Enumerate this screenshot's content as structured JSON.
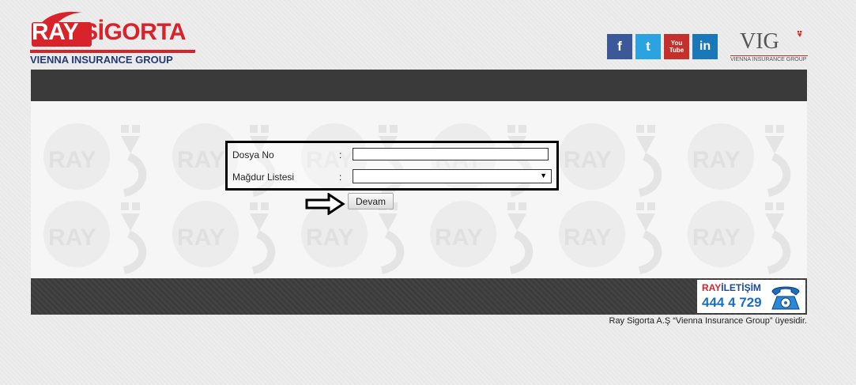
{
  "header": {
    "logo_ray": "RAY",
    "logo_sigorta": "SİGORTA",
    "logo_sub": "VIENNA INSURANCE GROUP",
    "social": {
      "facebook": "f",
      "twitter": "t",
      "youtube_top": "You",
      "youtube_bottom": "Tube",
      "linkedin": "in"
    },
    "vig_text": "VIG",
    "vig_sub": "VIENNA INSURANCE GROUP"
  },
  "form": {
    "dosya_label": "Dosya No",
    "dosya_colon": ":",
    "dosya_value": "",
    "magdur_label": "Mağdur Listesi",
    "magdur_colon": ":",
    "magdur_selected": "",
    "devam_label": "Devam"
  },
  "watermark_text": "RAY",
  "contact": {
    "ray": "RAY",
    "iletisim": "İLETİŞİM",
    "phone": "444 4 729"
  },
  "footer": {
    "note": "Ray Sigorta A.Ş “Vienna Insurance Group” üyesidir."
  },
  "colors": {
    "brand_red": "#d8232a",
    "brand_blue": "#243a78",
    "dark_bar": "#3a3a3a"
  }
}
